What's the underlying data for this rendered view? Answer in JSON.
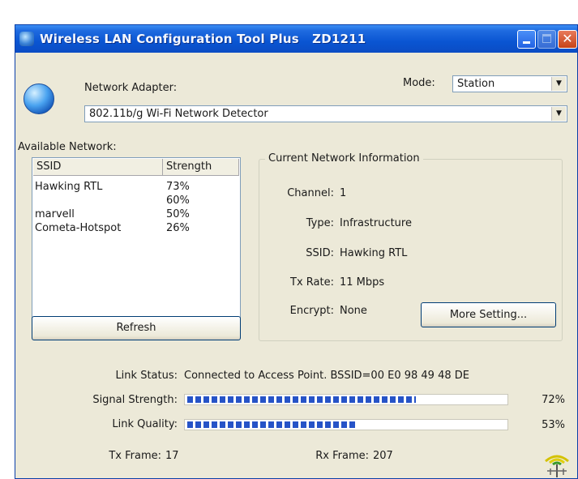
{
  "window": {
    "title": "Wireless LAN Configuration Tool Plus   ZD1211"
  },
  "adapter": {
    "label": "Network Adapter:",
    "selected": "802.11b/g Wi-Fi Network Detector"
  },
  "mode": {
    "label": "Mode:",
    "selected": "Station"
  },
  "available": {
    "label": "Available Network:",
    "columns": [
      "SSID",
      "Strength"
    ],
    "rows": [
      {
        "ssid": "Hawking RTL",
        "strength": "73%"
      },
      {
        "ssid": "",
        "strength": "60%"
      },
      {
        "ssid": "marvell",
        "strength": "50%"
      },
      {
        "ssid": "Cometa-Hotspot",
        "strength": "26%"
      }
    ],
    "refresh_label": "Refresh"
  },
  "current": {
    "title": "Current Network Information",
    "channel_label": "Channel:",
    "channel": "1",
    "type_label": "Type:",
    "type": "Infrastructure",
    "ssid_label": "SSID:",
    "ssid": "Hawking RTL",
    "txrate_label": "Tx Rate:",
    "txrate": "11 Mbps",
    "encrypt_label": "Encrypt:",
    "encrypt": "None",
    "more_label": "More Setting..."
  },
  "status": {
    "link_label": "Link Status:",
    "link_value": "Connected to Access Point. BSSID=00 E0 98 49 48 DE",
    "signal_label": "Signal Strength:",
    "signal_percent": 72,
    "signal_text": "72%",
    "quality_label": "Link Quality:",
    "quality_percent": 53,
    "quality_text": "53%",
    "tx_label": "Tx Frame:",
    "tx_value": "17",
    "rx_label": "Rx Frame:",
    "rx_value": "207"
  },
  "colors": {
    "titlebar": "#0a55d2",
    "window_bg": "#ece9d8",
    "progress_fill": "#2653c7"
  },
  "icons": [
    "adapter-globe-icon",
    "minimize-icon",
    "maximize-icon",
    "close-icon",
    "dropdown-arrow-icon",
    "antenna-icon"
  ]
}
